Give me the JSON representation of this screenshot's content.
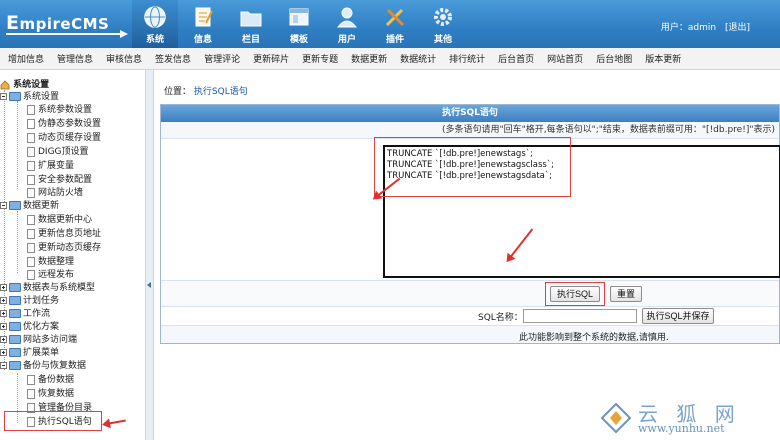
{
  "header": {
    "logo": "EmpireCMS",
    "nav": [
      {
        "label": "系统",
        "icon": "system-globe-icon",
        "active": true
      },
      {
        "label": "信息",
        "icon": "info-notepad-icon",
        "active": false
      },
      {
        "label": "栏目",
        "icon": "column-folder-icon",
        "active": false
      },
      {
        "label": "模板",
        "icon": "template-window-icon",
        "active": false
      },
      {
        "label": "用户",
        "icon": "user-person-icon",
        "active": false
      },
      {
        "label": "插件",
        "icon": "plugin-tools-icon",
        "active": false
      },
      {
        "label": "其他",
        "icon": "other-gear-icon",
        "active": false
      }
    ],
    "user_label": "用户：admin",
    "logout": "[退出]"
  },
  "toolbar": [
    "增加信息",
    "管理信息",
    "审核信息",
    "签发信息",
    "管理评论",
    "更新碎片",
    "更新专题",
    "数据更新",
    "数据统计",
    "排行统计",
    "后台首页",
    "网站首页",
    "后台地图",
    "版本更新"
  ],
  "sidebar": {
    "root": "系统设置",
    "groups": [
      {
        "label": "系统设置",
        "expanded": true,
        "items": [
          "系统参数设置",
          "伪静态参数设置",
          "动态页缓存设置",
          "DIGG顶设置",
          "扩展变量",
          "安全参数配置",
          "网站防火墙"
        ]
      },
      {
        "label": "数据更新",
        "expanded": true,
        "items": [
          "数据更新中心",
          "更新信息页地址",
          "更新动态页缓存",
          "数据整理",
          "远程发布"
        ]
      },
      {
        "label": "数据表与系统模型",
        "expanded": false,
        "items": []
      },
      {
        "label": "计划任务",
        "expanded": false,
        "items": []
      },
      {
        "label": "工作流",
        "expanded": false,
        "items": []
      },
      {
        "label": "优化方案",
        "expanded": false,
        "items": []
      },
      {
        "label": "网站多访问端",
        "expanded": false,
        "items": []
      },
      {
        "label": "扩展菜单",
        "expanded": false,
        "items": []
      },
      {
        "label": "备份与恢复数据",
        "expanded": true,
        "items": [
          "备份数据",
          "恢复数据",
          "管理备份目录",
          "执行SQL语句"
        ]
      }
    ]
  },
  "main": {
    "breadcrumb_prefix": "位置：",
    "breadcrumb_link": "执行SQL语句",
    "panel_title": "执行SQL语句",
    "hint": "(多条语句请用\"回车\"格开,每条语句以\";\"结束，数据表前缀可用：\"[!db.pre!]\"表示)",
    "sql_text": "TRUNCATE `[!db.pre!]enewstags`;\nTRUNCATE `[!db.pre!]enewstagsclass`;\nTRUNCATE `[!db.pre!]enewstagsdata`;",
    "exec_button": "执行SQL",
    "reset_button": "重置",
    "sql_name_label": "SQL名称：",
    "sql_name_value": "",
    "exec_save_button": "执行SQL并保存",
    "note": "此功能影响到整个系统的数据,请慎用."
  },
  "watermark": {
    "text": "云 狐 网",
    "url": "www.yunhu.net"
  },
  "colors": {
    "header_blue": "#2f7fc4",
    "annotation_red": "#e03030",
    "panel_head": "#3c7fc0"
  }
}
